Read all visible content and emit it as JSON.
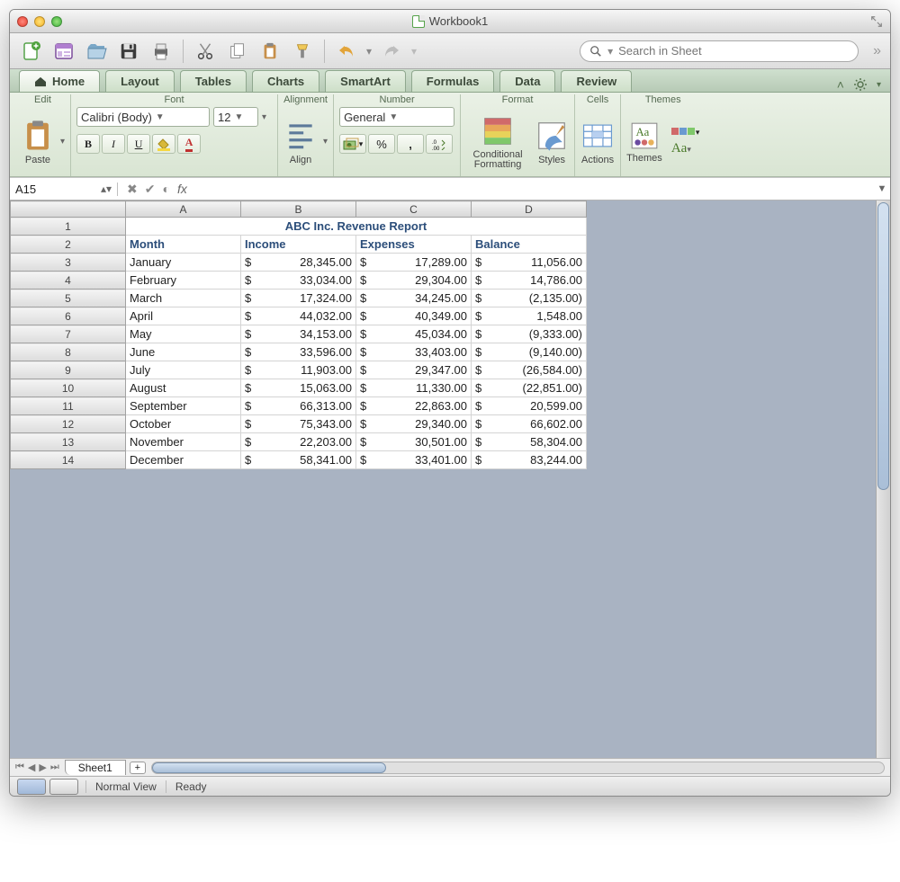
{
  "window": {
    "title": "Workbook1"
  },
  "search": {
    "placeholder": "Search in Sheet"
  },
  "ribbon_tabs": [
    "Home",
    "Layout",
    "Tables",
    "Charts",
    "SmartArt",
    "Formulas",
    "Data",
    "Review"
  ],
  "ribbon": {
    "edit_label": "Edit",
    "paste_label": "Paste",
    "font_group": "Font",
    "font_name": "Calibri (Body)",
    "font_size": "12",
    "alignment_group": "Alignment",
    "align_label": "Align",
    "number_group": "Number",
    "number_format": "General",
    "format_group": "Format",
    "conditional_label": "Conditional Formatting",
    "styles_label": "Styles",
    "cells_group": "Cells",
    "actions_label": "Actions",
    "themes_group": "Themes",
    "themes_label": "Themes",
    "aa_label": "Aa"
  },
  "namebox": "A15",
  "sheet": {
    "columns": [
      "A",
      "B",
      "C",
      "D"
    ],
    "title": "ABC Inc. Revenue Report",
    "headers": {
      "month": "Month",
      "income": "Income",
      "expenses": "Expenses",
      "balance": "Balance"
    },
    "rows": [
      {
        "n": "1"
      },
      {
        "n": "2"
      },
      {
        "n": "3",
        "month": "January",
        "income": "28,345.00",
        "expenses": "17,289.00",
        "balance": "11,056.00"
      },
      {
        "n": "4",
        "month": "February",
        "income": "33,034.00",
        "expenses": "29,304.00",
        "balance": "14,786.00"
      },
      {
        "n": "5",
        "month": "March",
        "income": "17,324.00",
        "expenses": "34,245.00",
        "balance": "(2,135.00)"
      },
      {
        "n": "6",
        "month": "April",
        "income": "44,032.00",
        "expenses": "40,349.00",
        "balance": "1,548.00"
      },
      {
        "n": "7",
        "month": "May",
        "income": "34,153.00",
        "expenses": "45,034.00",
        "balance": "(9,333.00)"
      },
      {
        "n": "8",
        "month": "June",
        "income": "33,596.00",
        "expenses": "33,403.00",
        "balance": "(9,140.00)"
      },
      {
        "n": "9",
        "month": "July",
        "income": "11,903.00",
        "expenses": "29,347.00",
        "balance": "(26,584.00)"
      },
      {
        "n": "10",
        "month": "August",
        "income": "15,063.00",
        "expenses": "11,330.00",
        "balance": "(22,851.00)"
      },
      {
        "n": "11",
        "month": "September",
        "income": "66,313.00",
        "expenses": "22,863.00",
        "balance": "20,599.00"
      },
      {
        "n": "12",
        "month": "October",
        "income": "75,343.00",
        "expenses": "29,340.00",
        "balance": "66,602.00"
      },
      {
        "n": "13",
        "month": "November",
        "income": "22,203.00",
        "expenses": "30,501.00",
        "balance": "58,304.00"
      },
      {
        "n": "14",
        "month": "December",
        "income": "58,341.00",
        "expenses": "33,401.00",
        "balance": "83,244.00"
      }
    ]
  },
  "sheet_tab": "Sheet1",
  "status": {
    "view": "Normal View",
    "ready": "Ready"
  },
  "currency_symbol": "$",
  "chart_data": {
    "type": "table",
    "title": "ABC Inc. Revenue Report",
    "columns": [
      "Month",
      "Income",
      "Expenses",
      "Balance"
    ],
    "rows": [
      [
        "January",
        28345.0,
        17289.0,
        11056.0
      ],
      [
        "February",
        33034.0,
        29304.0,
        14786.0
      ],
      [
        "March",
        17324.0,
        34245.0,
        -2135.0
      ],
      [
        "April",
        44032.0,
        40349.0,
        1548.0
      ],
      [
        "May",
        34153.0,
        45034.0,
        -9333.0
      ],
      [
        "June",
        33596.0,
        33403.0,
        -9140.0
      ],
      [
        "July",
        11903.0,
        29347.0,
        -26584.0
      ],
      [
        "August",
        15063.0,
        11330.0,
        -22851.0
      ],
      [
        "September",
        66313.0,
        22863.0,
        20599.0
      ],
      [
        "October",
        75343.0,
        29340.0,
        66602.0
      ],
      [
        "November",
        22203.0,
        30501.0,
        58304.0
      ],
      [
        "December",
        58341.0,
        33401.0,
        83244.0
      ]
    ]
  }
}
